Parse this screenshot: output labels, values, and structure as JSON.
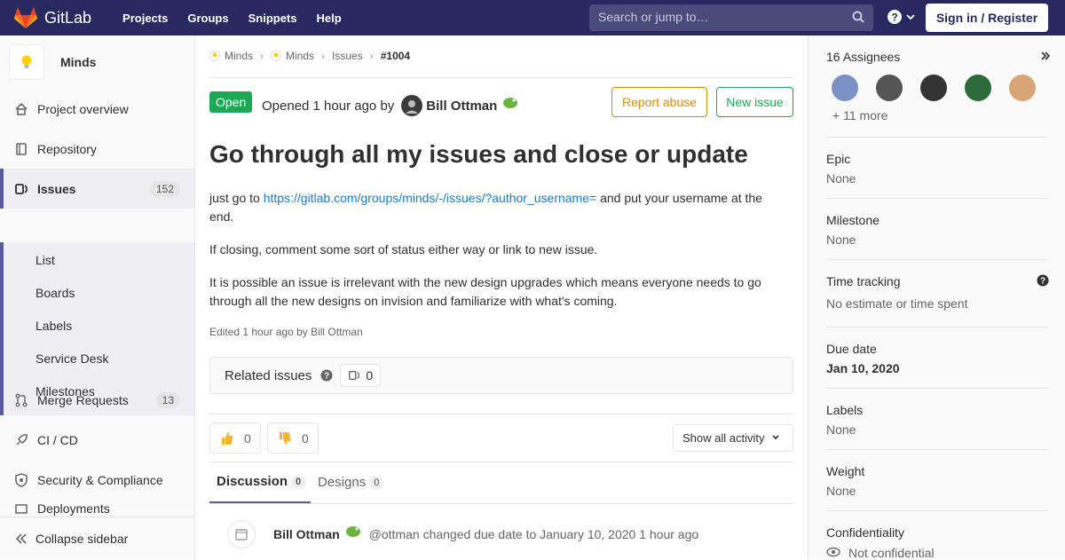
{
  "topbar": {
    "brand": "GitLab",
    "nav": [
      "Projects",
      "Groups",
      "Snippets",
      "Help"
    ],
    "search_placeholder": "Search or jump to…",
    "signin": "Sign in / Register"
  },
  "sidebar": {
    "project_name": "Minds",
    "items": [
      {
        "label": "Project overview"
      },
      {
        "label": "Repository"
      },
      {
        "label": "Issues",
        "count": "152"
      },
      {
        "label": "Merge Requests",
        "count": "13"
      },
      {
        "label": "CI / CD"
      },
      {
        "label": "Security & Compliance"
      },
      {
        "label": "Deployments"
      }
    ],
    "sub_items": [
      "List",
      "Boards",
      "Labels",
      "Service Desk",
      "Milestones"
    ],
    "collapse": "Collapse sidebar"
  },
  "breadcrumb": [
    "Minds",
    "Minds",
    "Issues",
    "#1004"
  ],
  "issue": {
    "status": "Open",
    "opened_text": "Opened 1 hour ago by",
    "author": "Bill Ottman",
    "report_abuse": "Report abuse",
    "new_issue": "New issue",
    "title": "Go through all my issues and close or update",
    "desc_p1_prefix": "just go to ",
    "desc_p1_link": "https://gitlab.com/groups/minds/-/issues/?author_username=",
    "desc_p1_suffix": " and put your username at the",
    "desc_p1_end": "end.",
    "desc_p2": "If closing, comment some sort of status either way or link to new issue.",
    "desc_p3a": "It is possible an issue is irrelevant with the new design upgrades which means everyone needs to go",
    "desc_p3b": "through all the new designs on invision and familiarize with what's coming.",
    "edited": "Edited 1 hour ago by Bill Ottman",
    "related_label": "Related issues",
    "related_count": "0",
    "thumbs_up": "0",
    "thumbs_down": "0",
    "activity_filter": "Show all activity"
  },
  "tabs": [
    {
      "label": "Discussion",
      "count": "0"
    },
    {
      "label": "Designs",
      "count": "0"
    }
  ],
  "note": {
    "author": "Bill Ottman",
    "text": "@ottman changed due date to January 10, 2020 1 hour ago"
  },
  "rightbar": {
    "assignees_title": "16 Assignees",
    "more": "+ 11 more",
    "epic_title": "Epic",
    "epic_val": "None",
    "milestone_title": "Milestone",
    "milestone_val": "None",
    "time_title": "Time tracking",
    "time_val": "No estimate or time spent",
    "due_title": "Due date",
    "due_val": "Jan 10, 2020",
    "labels_title": "Labels",
    "labels_val": "None",
    "weight_title": "Weight",
    "weight_val": "None",
    "conf_title": "Confidentiality",
    "conf_val": "Not confidential"
  },
  "colors": {
    "accent": "#292961",
    "open_green": "#1aaa55",
    "link": "#1f78d1",
    "warn": "#db8b00"
  }
}
